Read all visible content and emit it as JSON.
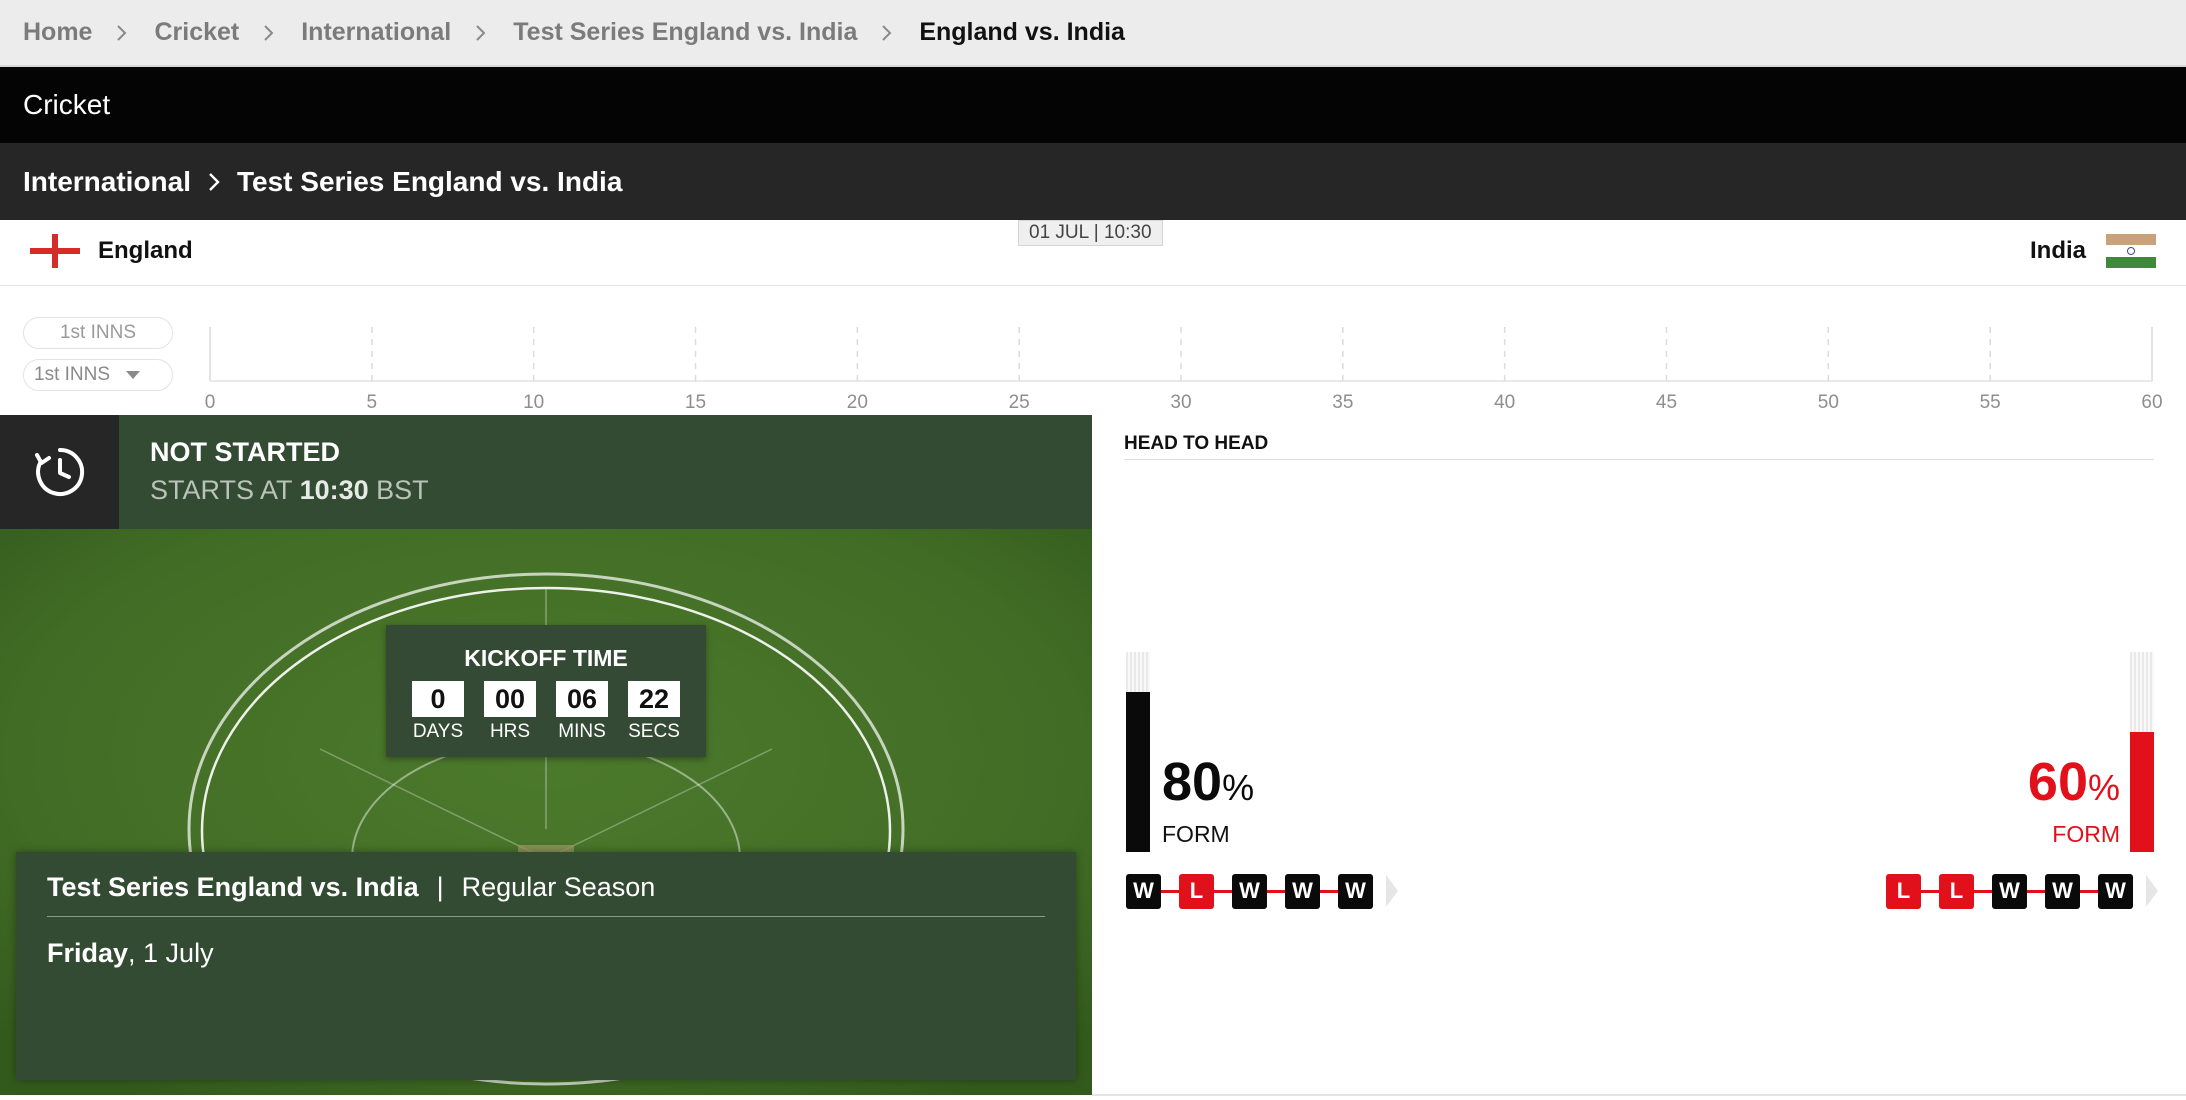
{
  "breadcrumb": [
    {
      "label": "Home"
    },
    {
      "label": "Cricket"
    },
    {
      "label": "International"
    },
    {
      "label": "Test Series England vs. India"
    },
    {
      "label": "England vs. India"
    }
  ],
  "sport": "Cricket",
  "competition": {
    "parent": "International",
    "name": "Test Series England vs. India"
  },
  "teams": {
    "home": {
      "name": "England"
    },
    "away": {
      "name": "India"
    }
  },
  "date_tag": "01 JUL | 10:30",
  "innings": {
    "pill": "1st INNS",
    "select": "1st INNS",
    "ticks": [
      "0",
      "5",
      "10",
      "15",
      "20",
      "25",
      "30",
      "35",
      "40",
      "45",
      "50",
      "55",
      "60"
    ]
  },
  "status": {
    "title": "NOT STARTED",
    "starts_prefix": "STARTS AT",
    "start_time": "10:30",
    "timezone": "BST"
  },
  "kickoff": {
    "title": "KICKOFF TIME",
    "units": [
      {
        "value": "0",
        "label": "DAYS"
      },
      {
        "value": "00",
        "label": "HRS"
      },
      {
        "value": "06",
        "label": "MINS"
      },
      {
        "value": "22",
        "label": "SECS"
      }
    ]
  },
  "match_info": {
    "series": "Test Series England vs. India",
    "separator": "|",
    "season": "Regular Season",
    "day": "Friday",
    "date": ", 1 July"
  },
  "h2h": {
    "title": "HEAD TO HEAD",
    "home": {
      "pct": "80",
      "pct_symbol": "%",
      "label": "FORM",
      "form_fraction": 0.8,
      "results": [
        "W",
        "L",
        "W",
        "W",
        "W"
      ],
      "color": "#0a0a0a"
    },
    "away": {
      "pct": "60",
      "pct_symbol": "%",
      "label": "FORM",
      "form_fraction": 0.6,
      "results": [
        "L",
        "L",
        "W",
        "W",
        "W"
      ],
      "color": "#e2101b"
    }
  },
  "colors": {
    "accent_red": "#e2101b",
    "field_green": "#416c25",
    "status_green": "#334a33"
  }
}
